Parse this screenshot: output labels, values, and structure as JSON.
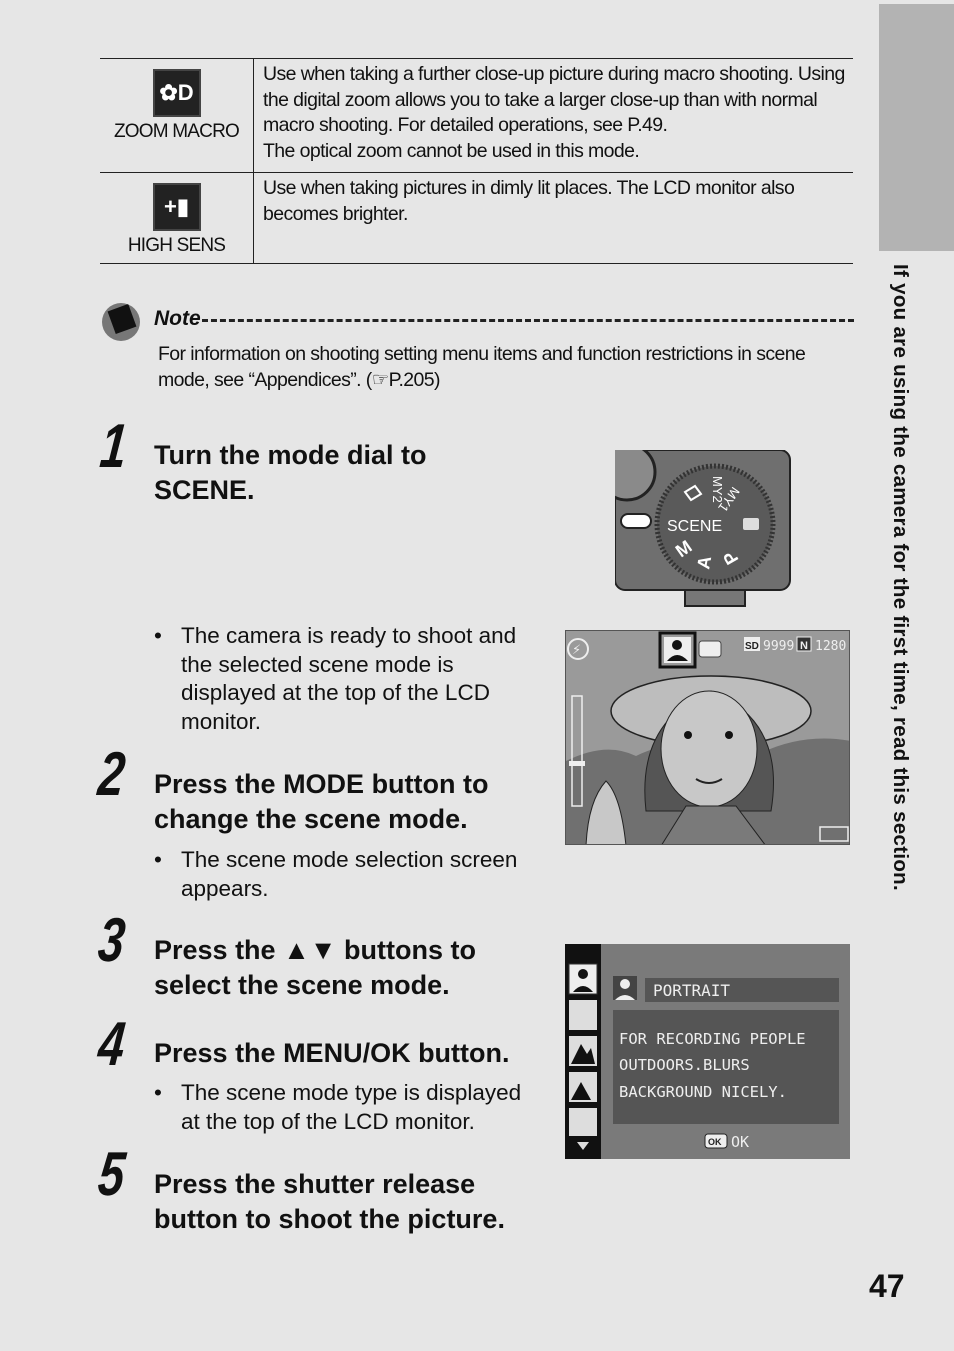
{
  "side_tab": {
    "text": "If you are using the camera for the first time, read this section."
  },
  "modes_table": [
    {
      "icon": "zoom-macro-icon",
      "glyph": "✿D",
      "label": "ZOOM MACRO",
      "lines": [
        "Use when taking a further close-up picture during macro shooting. Using",
        "the digital zoom allows you to take a larger close-up than with normal",
        "macro shooting. For detailed operations, see P.49.",
        "The optical zoom cannot be used in this mode."
      ]
    },
    {
      "icon": "high-sens-icon",
      "glyph": "+▮",
      "label": "HIGH SENS",
      "lines": [
        "Use when taking pictures in dimly lit places. The LCD monitor also",
        "becomes brighter."
      ]
    }
  ],
  "note": {
    "heading": "Note",
    "lines": [
      "For information on shooting setting menu items and function restrictions in scene",
      "mode, see “Appendices”. (☞P.205)"
    ]
  },
  "steps": [
    {
      "num": "1",
      "title_lines": [
        "Turn the mode dial to",
        "SCENE."
      ],
      "bullet_lines": [
        "The camera is ready to shoot and",
        "the selected scene mode is",
        "displayed at the top of the LCD",
        "monitor."
      ]
    },
    {
      "num": "2",
      "title_lines": [
        "Press the MODE button to",
        "change the scene mode."
      ],
      "bullet_lines": [
        "The scene mode selection screen",
        "appears."
      ]
    },
    {
      "num": "3",
      "title_lines": [
        "Press the ▲▼ buttons to",
        "select the scene mode."
      ],
      "bullet_lines": []
    },
    {
      "num": "4",
      "title_lines": [
        "Press the MENU/OK button."
      ],
      "bullet_lines": [
        "The scene mode type is displayed",
        "at the top of the LCD monitor."
      ]
    },
    {
      "num": "5",
      "title_lines": [
        "Press the shutter release",
        "button to shoot the picture."
      ],
      "bullet_lines": []
    }
  ],
  "dial": {
    "labels": [
      "SCENE",
      "MY2",
      "MY1",
      "M",
      "A",
      "P"
    ]
  },
  "lcd_preview": {
    "card": "SD",
    "shots": "9999",
    "quality": "N",
    "size": "1280"
  },
  "lcd_menu": {
    "mode_name": "PORTRAIT",
    "description_lines": [
      "FOR RECORDING PEOPLE",
      "OUTDOORS.BLURS",
      "BACKGROUND NICELY."
    ],
    "ok_badge": "OK",
    "ok_label": "OK"
  },
  "page_number": "47"
}
